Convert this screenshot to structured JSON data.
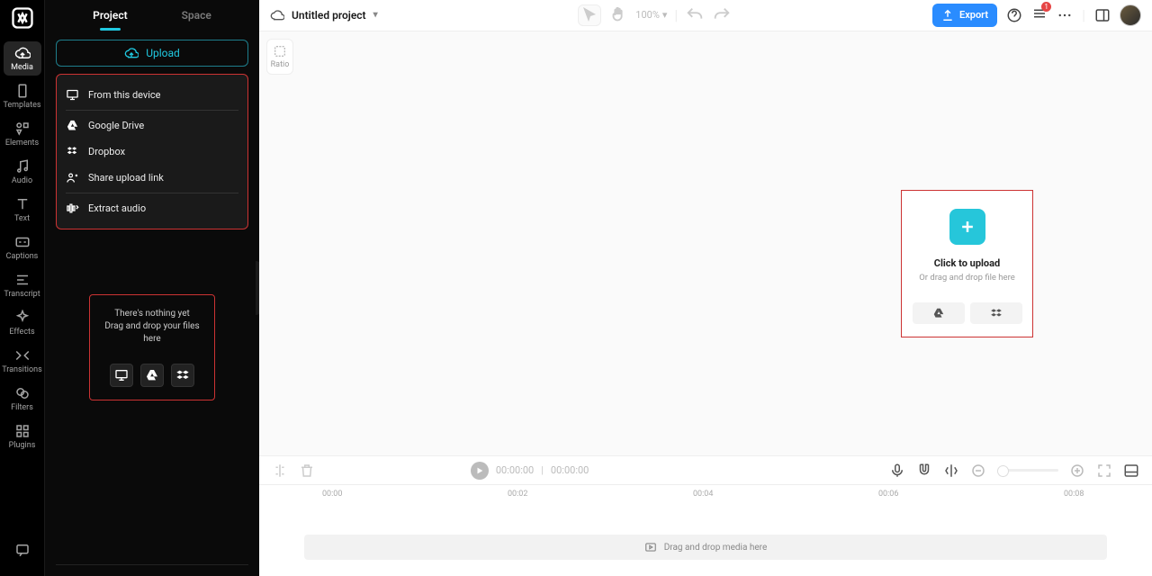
{
  "rail": {
    "items": [
      {
        "label": "Media"
      },
      {
        "label": "Templates"
      },
      {
        "label": "Elements"
      },
      {
        "label": "Audio"
      },
      {
        "label": "Text"
      },
      {
        "label": "Captions"
      },
      {
        "label": "Transcript"
      },
      {
        "label": "Effects"
      },
      {
        "label": "Transitions"
      },
      {
        "label": "Filters"
      },
      {
        "label": "Plugins"
      }
    ]
  },
  "side": {
    "tabs": {
      "project": "Project",
      "space": "Space"
    },
    "upload_label": "Upload",
    "menu": {
      "device": "From this device",
      "gdrive": "Google Drive",
      "dropbox": "Dropbox",
      "share": "Share upload link",
      "extract": "Extract audio"
    },
    "empty_line1": "There's nothing yet",
    "empty_line2": "Drag and drop your files here"
  },
  "top": {
    "project_title": "Untitled project",
    "zoom": "100%",
    "export": "Export",
    "notif_count": "1"
  },
  "preview": {
    "ratio_label": "Ratio",
    "upload_title": "Click to upload",
    "upload_sub": "Or drag and drop file here"
  },
  "timeline": {
    "pos": "00:00:00",
    "dur": "00:00:00",
    "ticks": [
      "00:00",
      "00:02",
      "00:04",
      "00:06",
      "00:08"
    ],
    "drop_text": "Drag and drop media here"
  }
}
